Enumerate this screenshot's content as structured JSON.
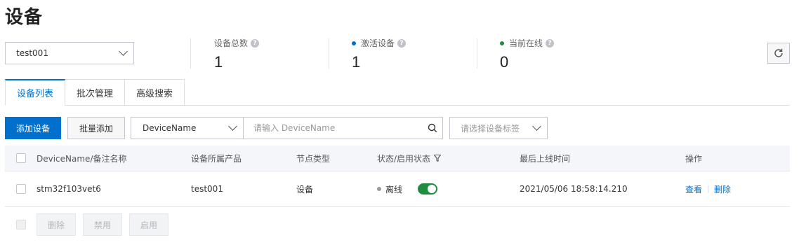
{
  "page": {
    "title": "设备"
  },
  "product_select": {
    "value": "test001"
  },
  "stats": [
    {
      "label": "设备总数",
      "value": "1",
      "dot": ""
    },
    {
      "label": "激活设备",
      "value": "1",
      "dot": "blue"
    },
    {
      "label": "当前在线",
      "value": "0",
      "dot": "green"
    }
  ],
  "tabs": [
    {
      "label": "设备列表",
      "active": true
    },
    {
      "label": "批次管理",
      "active": false
    },
    {
      "label": "高级搜索",
      "active": false
    }
  ],
  "toolbar": {
    "add_label": "添加设备",
    "batch_add_label": "批量添加",
    "search_type": "DeviceName",
    "search_placeholder": "请输入 DeviceName",
    "tag_placeholder": "请选择设备标签"
  },
  "table": {
    "headers": {
      "name": "DeviceName/备注名称",
      "product": "设备所属产品",
      "node_type": "节点类型",
      "status": "状态/启用状态",
      "last_online": "最后上线时间",
      "actions": "操作"
    },
    "rows": [
      {
        "name": "stm32f103vet6",
        "product": "test001",
        "node_type": "设备",
        "status": "离线",
        "enabled": true,
        "last_online": "2021/05/06 18:58:14.210",
        "action_view": "查看",
        "action_delete": "删除"
      }
    ]
  },
  "bulk_actions": {
    "delete": "删除",
    "disable": "禁用",
    "enable": "启用"
  },
  "colors": {
    "primary": "#0070cc",
    "online_green": "#1e8e3e",
    "offline_gray": "#999999"
  }
}
